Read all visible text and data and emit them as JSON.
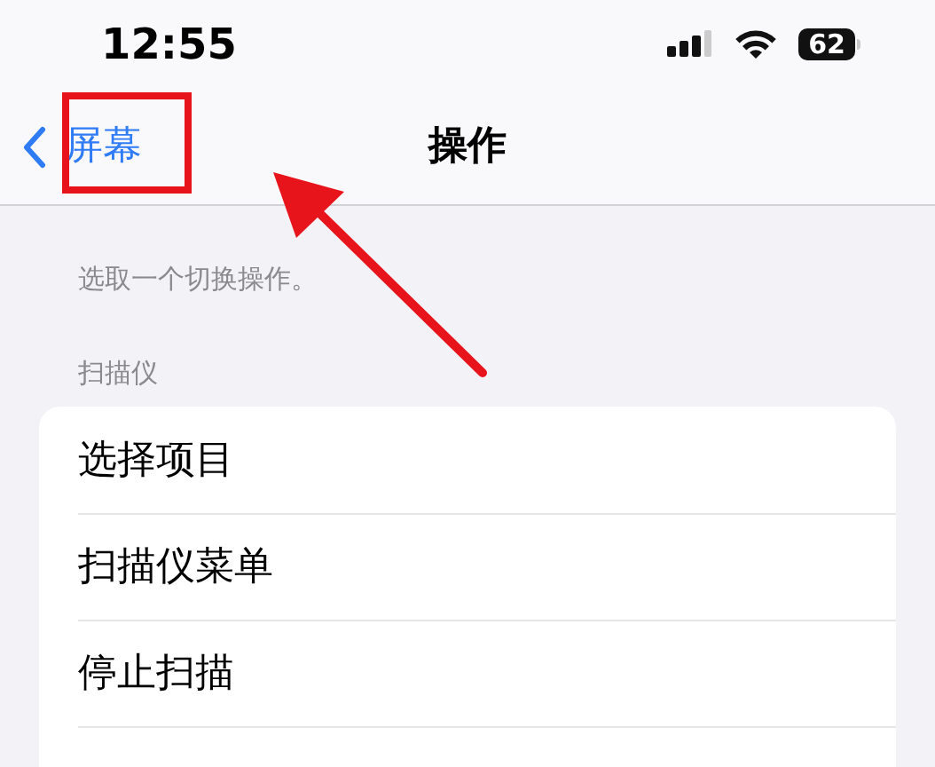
{
  "status_bar": {
    "time": "12:55",
    "battery": "62"
  },
  "nav_bar": {
    "back_label": "屏幕",
    "title": "操作"
  },
  "description": "选取一个切换操作。",
  "section_header": "扫描仪",
  "items": [
    {
      "label": "选择项目"
    },
    {
      "label": "扫描仪菜单"
    },
    {
      "label": "停止扫描"
    }
  ],
  "annotation": {
    "highlight_box": true,
    "arrow": true
  }
}
